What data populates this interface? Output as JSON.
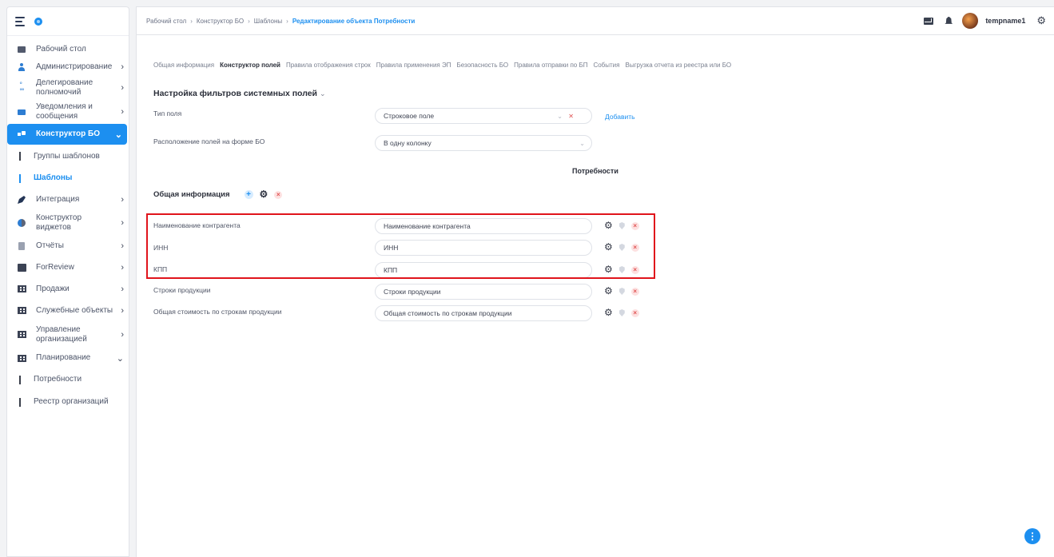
{
  "sidebar": {
    "items": [
      {
        "label": "Рабочий стол",
        "icon": "desktop-icon"
      },
      {
        "label": "Администрирование",
        "icon": "admin-icon",
        "chevron": "›"
      },
      {
        "label": "Делегирование полномочий",
        "icon": "delegation-icon",
        "chevron": "›"
      },
      {
        "label": "Уведомления и сообщения",
        "icon": "notifications-icon",
        "chevron": "›"
      },
      {
        "label": "Конструктор БО",
        "icon": "constructor-icon",
        "chevron": "⌄"
      },
      {
        "label": "Группы шаблонов"
      },
      {
        "label": "Шаблоны"
      },
      {
        "label": "Интеграция",
        "icon": "integration-icon",
        "chevron": "›"
      },
      {
        "label": "Конструктор виджетов",
        "icon": "widgets-icon",
        "chevron": "›"
      },
      {
        "label": "Отчёты",
        "icon": "reports-icon",
        "chevron": "›"
      },
      {
        "label": "ForReview",
        "icon": "review-icon",
        "chevron": "›"
      },
      {
        "label": "Продажи",
        "icon": "sales-icon",
        "chevron": "›"
      },
      {
        "label": "Служебные объекты",
        "icon": "service-objects-icon",
        "chevron": "›"
      },
      {
        "label": "Управление организацией",
        "icon": "org-management-icon",
        "chevron": "›"
      },
      {
        "label": "Планирование",
        "icon": "planning-icon",
        "chevron": "⌄"
      },
      {
        "label": "Потребности"
      },
      {
        "label": "Реестр организаций"
      }
    ]
  },
  "header": {
    "breadcrumb": [
      "Рабочий стол",
      "Конструктор БО",
      "Шаблоны",
      "Редактирование объекта Потребности"
    ],
    "separator": "›",
    "username": "tempname1"
  },
  "tabs": [
    {
      "label": "Общая информация",
      "active": false
    },
    {
      "label": "Конструктор полей",
      "active": true
    },
    {
      "label": "Правила отображения строк",
      "active": false
    },
    {
      "label": "Правила применения ЭП",
      "active": false
    },
    {
      "label": "Безопасность БО",
      "active": false
    },
    {
      "label": "Правила отправки по БП",
      "active": false
    },
    {
      "label": "События",
      "active": false
    },
    {
      "label": "Выгрузка отчета из реестра или БО",
      "active": false
    }
  ],
  "filters": {
    "title": "Настройка фильтров системных полей",
    "field_type_label": "Тип поля",
    "field_type_value": "Строковое поле",
    "add_label": "Добавить",
    "layout_label": "Расположение полей на форме БО",
    "layout_value": "В одну колонку"
  },
  "column_title": "Потребности",
  "group": {
    "title": "Общая информация",
    "fields": [
      {
        "label": "Наименование контрагента",
        "value": "Наименование контрагента"
      },
      {
        "label": "ИНН",
        "value": "ИНН"
      },
      {
        "label": "КПП",
        "value": "КПП"
      },
      {
        "label": "Строки продукции",
        "value": "Строки продукции"
      },
      {
        "label": "Общая стоимость по строкам продукции",
        "value": "Общая стоимость по строкам продукции"
      }
    ]
  },
  "colors": {
    "accent": "#1c8ff0",
    "highlight": "#e0141c",
    "delete": "#e05454"
  }
}
